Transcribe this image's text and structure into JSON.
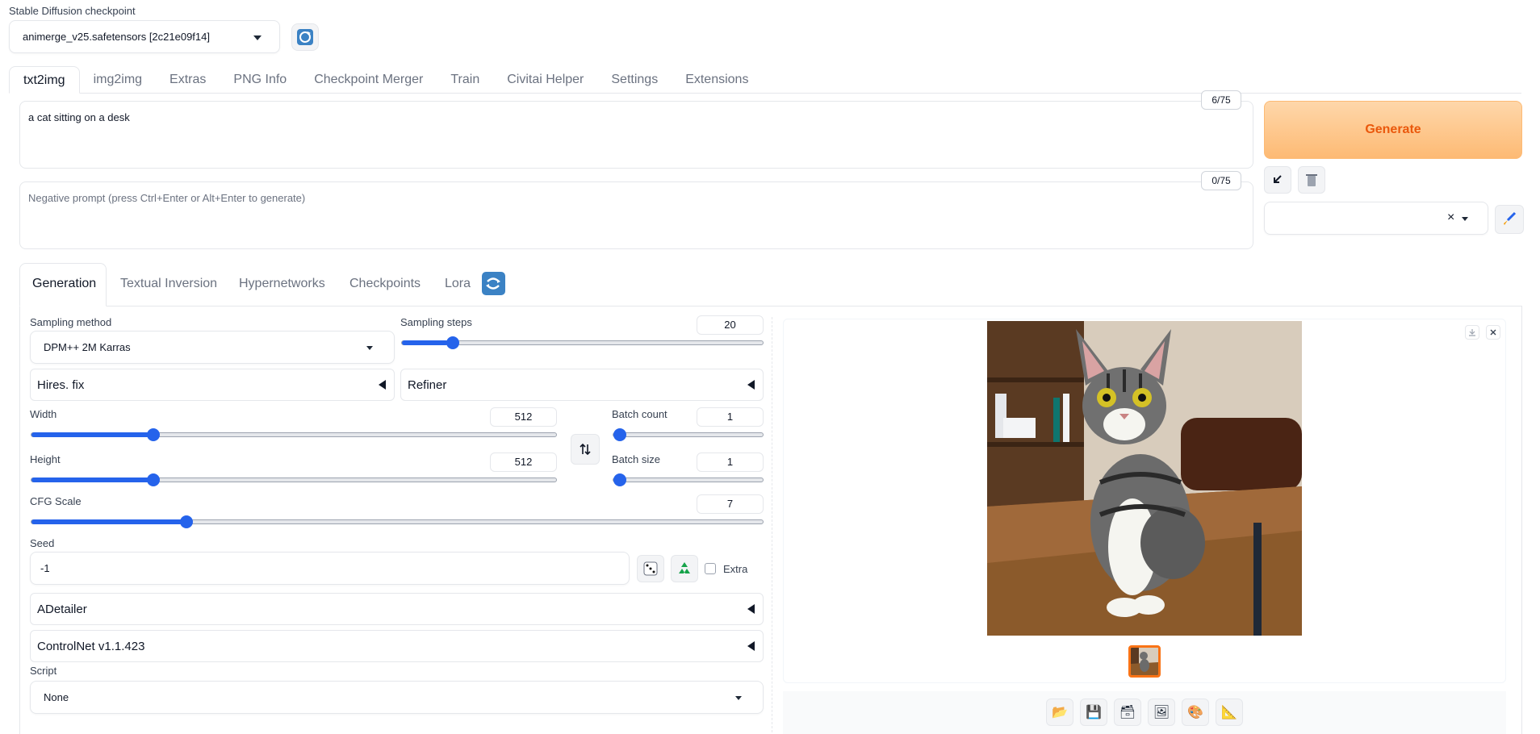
{
  "checkpoint": {
    "label": "Stable Diffusion checkpoint",
    "value": "animerge_v25.safetensors [2c21e09f14]"
  },
  "tabs": [
    "txt2img",
    "img2img",
    "Extras",
    "PNG Info",
    "Checkpoint Merger",
    "Train",
    "Civitai Helper",
    "Settings",
    "Extensions"
  ],
  "prompt": {
    "value": "a cat sitting on a desk",
    "counter": "6/75"
  },
  "negative_prompt": {
    "placeholder": "Negative prompt (press Ctrl+Enter or Alt+Enter to generate)",
    "counter": "0/75"
  },
  "generate_label": "Generate",
  "style_clear": "×",
  "subtabs": [
    "Generation",
    "Textual Inversion",
    "Hypernetworks",
    "Checkpoints",
    "Lora"
  ],
  "sampling": {
    "method_label": "Sampling method",
    "method_value": "DPM++ 2M Karras",
    "steps_label": "Sampling steps",
    "steps_value": "20",
    "steps_min": 1,
    "steps_max": 150
  },
  "hires_label": "Hires. fix",
  "refiner_label": "Refiner",
  "width": {
    "label": "Width",
    "value": "512",
    "min": 64,
    "max": 2048
  },
  "height": {
    "label": "Height",
    "value": "512",
    "min": 64,
    "max": 2048
  },
  "batch_count": {
    "label": "Batch count",
    "value": "1",
    "min": 1,
    "max": 100
  },
  "batch_size": {
    "label": "Batch size",
    "value": "1",
    "min": 1,
    "max": 8
  },
  "cfg": {
    "label": "CFG Scale",
    "value": "7",
    "min": 1,
    "max": 30
  },
  "seed": {
    "label": "Seed",
    "value": "-1",
    "extra_label": "Extra"
  },
  "adetailer_label": "ADetailer",
  "controlnet_label": "ControlNet v1.1.423",
  "script": {
    "label": "Script",
    "value": "None"
  },
  "colors": {
    "accent": "#2563eb",
    "generate": "#ea580c",
    "thumb_border": "#f97316"
  },
  "output_tools": [
    "folder-icon",
    "save-icon",
    "zip-icon",
    "send-to-img2img-icon",
    "send-to-inpaint-icon",
    "send-to-extras-icon"
  ]
}
